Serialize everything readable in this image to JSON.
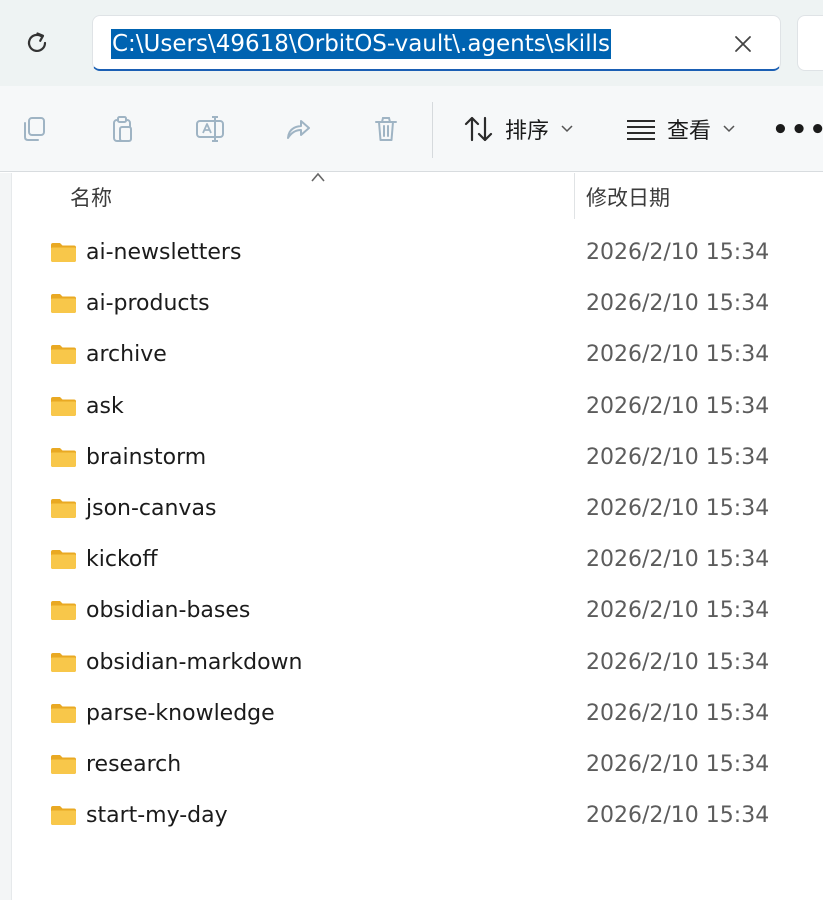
{
  "address_bar": {
    "path": "C:\\Users\\49618\\OrbitOS-vault\\.agents\\skills"
  },
  "toolbar": {
    "sort_label": "排序",
    "view_label": "查看",
    "more_label": "•••"
  },
  "columns": {
    "name": "名称",
    "modified": "修改日期"
  },
  "files": [
    {
      "name": "ai-newsletters",
      "modified": "2026/2/10 15:34"
    },
    {
      "name": "ai-products",
      "modified": "2026/2/10 15:34"
    },
    {
      "name": "archive",
      "modified": "2026/2/10 15:34"
    },
    {
      "name": "ask",
      "modified": "2026/2/10 15:34"
    },
    {
      "name": "brainstorm",
      "modified": "2026/2/10 15:34"
    },
    {
      "name": "json-canvas",
      "modified": "2026/2/10 15:34"
    },
    {
      "name": "kickoff",
      "modified": "2026/2/10 15:34"
    },
    {
      "name": "obsidian-bases",
      "modified": "2026/2/10 15:34"
    },
    {
      "name": "obsidian-markdown",
      "modified": "2026/2/10 15:34"
    },
    {
      "name": "parse-knowledge",
      "modified": "2026/2/10 15:34"
    },
    {
      "name": "research",
      "modified": "2026/2/10 15:34"
    },
    {
      "name": "start-my-day",
      "modified": "2026/2/10 15:34"
    }
  ],
  "colors": {
    "selection": "#0063b1",
    "folder": "#f8c74a",
    "disabled_icon": "#9fb4c4"
  }
}
